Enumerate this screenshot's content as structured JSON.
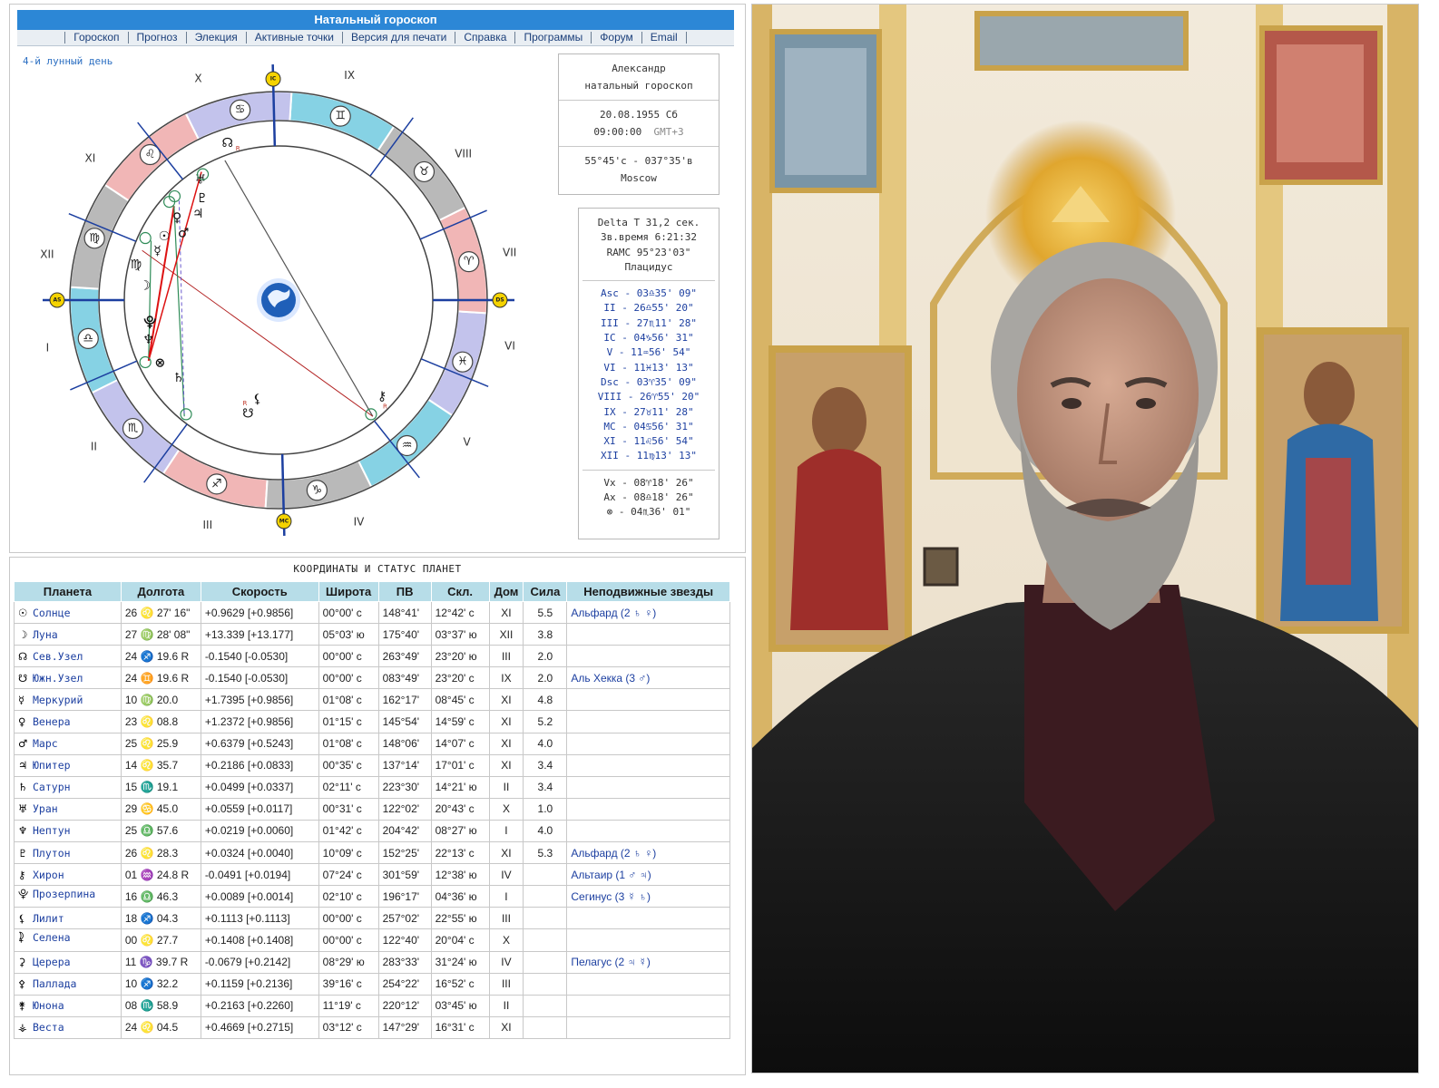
{
  "header": {
    "title": "Натальный гороскоп",
    "menu": [
      "Гороскоп",
      "Прогноз",
      "Элекция",
      "Активные точки",
      "Версия для печати",
      "Справка",
      "Программы",
      "Форум",
      "Email"
    ]
  },
  "lunar_day": "4-й лунный день",
  "info": {
    "name": "Александр",
    "subtitle": "натальный гороскоп",
    "date": "20.08.1955 Сб",
    "time": "09:00:00",
    "gmt": "GMT+3",
    "coords": "55°45'с - 037°35'в",
    "city": "Moscow",
    "delta_t": "Delta T  31,2 сек.",
    "sidereal": "Зв.время 6:21:32",
    "ramc": "RAMC 95°23'03\"",
    "system": "Плацидус",
    "cusps": [
      "Asc - 03♎35' 09\"",
      "II - 26♎55' 20\"",
      "III - 27♏11' 28\"",
      "IC - 04♑56' 31\"",
      "V - 11♒56' 54\"",
      "VI - 11♓13' 13\"",
      "Dsc - 03♈35' 09\"",
      "VIII - 26♈55' 20\"",
      "IX - 27♉11' 28\"",
      "MC - 04♋56' 31\"",
      "XI - 11♌56' 54\"",
      "XII - 11♍13' 13\""
    ],
    "extra": [
      "Vx - 08♈18' 26\"",
      "Ax - 08♎18' 26\"",
      "⊗ - 04♏36' 01\""
    ]
  },
  "wheel": {
    "houses_roman": [
      "I",
      "II",
      "III",
      "IV",
      "V",
      "VI",
      "VII",
      "VIII",
      "IX",
      "X",
      "XI",
      "XII"
    ],
    "angle_labels": [
      "AS",
      "DS",
      "MC",
      "IC"
    ],
    "zodiac_glyphs": [
      "♎",
      "♏",
      "♐",
      "♑",
      "♒",
      "♓",
      "♈",
      "♉",
      "♊",
      "♋",
      "♌",
      "♍"
    ],
    "chart_planet_glyphs": [
      "☊",
      "♅",
      "♇",
      "♃",
      "♀",
      "♂",
      "☉",
      "☿",
      "♍",
      "☽",
      "⯓",
      "♆",
      "⊗",
      "♄",
      "⚷",
      "☋",
      "⚸",
      "♐"
    ],
    "retro_mark": "R",
    "colors": {
      "fire": "#f1b6b6",
      "earth": "#b9b9b9",
      "air": "#86d2e4",
      "water": "#c3c3ec",
      "accent": "#2c87d6"
    }
  },
  "table": {
    "title": "КООРДИНАТЫ И СТАТУС ПЛАНЕТ",
    "headers": [
      "Планета",
      "Долгота",
      "Скорость",
      "Широта",
      "ПВ",
      "Скл.",
      "Дом",
      "Сила",
      "Неподвижные звезды"
    ],
    "rows": [
      {
        "glyph": "☉",
        "name": "Солнце",
        "lon": "26 ♌ 27' 16\"",
        "speed": "+0.9629 [+0.9856]",
        "lat": "00°00' с",
        "ra": "148°41'",
        "dec": "12°42' с",
        "house": "XI",
        "power": "5.5",
        "star": "Альфард (2 ♄ ♀)"
      },
      {
        "glyph": "☽",
        "name": "Луна",
        "lon": "27 ♍ 28' 08\"",
        "speed": "+13.339 [+13.177]",
        "lat": "05°03' ю",
        "ra": "175°40'",
        "dec": "03°37' ю",
        "house": "XII",
        "power": "3.8",
        "star": ""
      },
      {
        "glyph": "☊",
        "name": "Сев.Узел",
        "lon": "24 ♐ 19.6  R",
        "speed": "-0.1540 [-0.0530]",
        "lat": "00°00' с",
        "ra": "263°49'",
        "dec": "23°20' ю",
        "house": "III",
        "power": "2.0",
        "star": ""
      },
      {
        "glyph": "☋",
        "name": "Южн.Узел",
        "lon": "24 ♊ 19.6  R",
        "speed": "-0.1540 [-0.0530]",
        "lat": "00°00' с",
        "ra": "083°49'",
        "dec": "23°20' с",
        "house": "IX",
        "power": "2.0",
        "star": "Аль Хекка (3 ♂)"
      },
      {
        "glyph": "☿",
        "name": "Меркурий",
        "lon": "10 ♍ 20.0",
        "speed": "+1.7395 [+0.9856]",
        "lat": "01°08' с",
        "ra": "162°17'",
        "dec": "08°45' с",
        "house": "XI",
        "power": "4.8",
        "star": ""
      },
      {
        "glyph": "♀",
        "name": "Венера",
        "lon": "23 ♌ 08.8",
        "speed": "+1.2372 [+0.9856]",
        "lat": "01°15' с",
        "ra": "145°54'",
        "dec": "14°59' с",
        "house": "XI",
        "power": "5.2",
        "star": ""
      },
      {
        "glyph": "♂",
        "name": "Марс",
        "lon": "25 ♌ 25.9",
        "speed": "+0.6379 [+0.5243]",
        "lat": "01°08' с",
        "ra": "148°06'",
        "dec": "14°07' с",
        "house": "XI",
        "power": "4.0",
        "star": ""
      },
      {
        "glyph": "♃",
        "name": "Юпитер",
        "lon": "14 ♌ 35.7",
        "speed": "+0.2186 [+0.0833]",
        "lat": "00°35' с",
        "ra": "137°14'",
        "dec": "17°01' с",
        "house": "XI",
        "power": "3.4",
        "star": ""
      },
      {
        "glyph": "♄",
        "name": "Сатурн",
        "lon": "15 ♏ 19.1",
        "speed": "+0.0499 [+0.0337]",
        "lat": "02°11' с",
        "ra": "223°30'",
        "dec": "14°21' ю",
        "house": "II",
        "power": "3.4",
        "star": ""
      },
      {
        "glyph": "♅",
        "name": "Уран",
        "lon": "29 ♋ 45.0",
        "speed": "+0.0559 [+0.0117]",
        "lat": "00°31' с",
        "ra": "122°02'",
        "dec": "20°43' с",
        "house": "X",
        "power": "1.0",
        "star": ""
      },
      {
        "glyph": "♆",
        "name": "Нептун",
        "lon": "25 ♎ 57.6",
        "speed": "+0.0219 [+0.0060]",
        "lat": "01°42' с",
        "ra": "204°42'",
        "dec": "08°27' ю",
        "house": "I",
        "power": "4.0",
        "star": ""
      },
      {
        "glyph": "♇",
        "name": "Плутон",
        "lon": "26 ♌ 28.3",
        "speed": "+0.0324 [+0.0040]",
        "lat": "10°09' с",
        "ra": "152°25'",
        "dec": "22°13' с",
        "house": "XI",
        "power": "5.3",
        "star": "Альфард (2 ♄ ♀)"
      },
      {
        "glyph": "⚷",
        "name": "Хирон",
        "lon": "01 ♒ 24.8  R",
        "speed": "-0.0491 [+0.0194]",
        "lat": "07°24' с",
        "ra": "301°59'",
        "dec": "12°38' ю",
        "house": "IV",
        "power": "",
        "star": "Альтаир (1 ♂ ♃)"
      },
      {
        "glyph": "⯓",
        "name": "Прозерпина",
        "lon": "16 ♎ 46.3",
        "speed": "+0.0089 [+0.0014]",
        "lat": "02°10' с",
        "ra": "196°17'",
        "dec": "04°36' ю",
        "house": "I",
        "power": "",
        "star": "Сегинус (3 ☿ ♄)"
      },
      {
        "glyph": "⚸",
        "name": "Лилит",
        "lon": "18 ♐ 04.3",
        "speed": "+0.1113 [+0.1113]",
        "lat": "00°00' с",
        "ra": "257°02'",
        "dec": "22°55' ю",
        "house": "III",
        "power": "",
        "star": ""
      },
      {
        "glyph": "⯝",
        "name": "Селена",
        "lon": "00 ♌ 27.7",
        "speed": "+0.1408 [+0.1408]",
        "lat": "00°00' с",
        "ra": "122°40'",
        "dec": "20°04' с",
        "house": "X",
        "power": "",
        "star": ""
      },
      {
        "glyph": "⚳",
        "name": "Церера",
        "lon": "11 ♑ 39.7  R",
        "speed": "-0.0679 [+0.2142]",
        "lat": "08°29' ю",
        "ra": "283°33'",
        "dec": "31°24' ю",
        "house": "IV",
        "power": "",
        "star": "Пелагус (2 ♃ ☿)"
      },
      {
        "glyph": "⚴",
        "name": "Паллада",
        "lon": "10 ♐ 32.2",
        "speed": "+0.1159 [+0.2136]",
        "lat": "39°16' с",
        "ra": "254°22'",
        "dec": "16°52' с",
        "house": "III",
        "power": "",
        "star": ""
      },
      {
        "glyph": "⚵",
        "name": "Юнона",
        "lon": "08 ♏ 58.9",
        "speed": "+0.2163 [+0.2260]",
        "lat": "11°19' с",
        "ra": "220°12'",
        "dec": "03°45' ю",
        "house": "II",
        "power": "",
        "star": ""
      },
      {
        "glyph": "⚶",
        "name": "Веста",
        "lon": "24 ♌ 04.5",
        "speed": "+0.4669 [+0.2715]",
        "lat": "03°12' с",
        "ra": "147°29'",
        "dec": "16°31' с",
        "house": "XI",
        "power": "",
        "star": ""
      }
    ]
  }
}
